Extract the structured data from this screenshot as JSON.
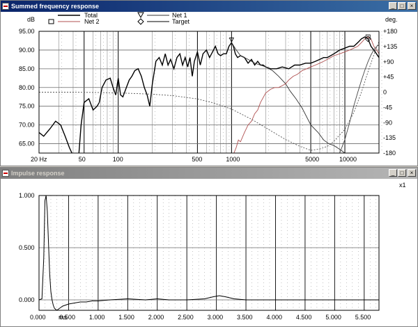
{
  "windows": {
    "freq": {
      "title": "Summed frequency response",
      "y_unit_left": "dB",
      "y_unit_right": "deg.",
      "legend": {
        "total": "Total",
        "net1": "Net 1",
        "net2": "Net 2",
        "target": "Target"
      },
      "controls": {
        "minimize": "_",
        "maximize": "□",
        "close": "×"
      }
    },
    "impulse": {
      "title": "Impulse response",
      "scale_label": "x1",
      "x_unit_label": "ms",
      "controls": {
        "minimize": "_",
        "maximize": "□",
        "close": "×"
      }
    }
  },
  "chart_data": [
    {
      "type": "line",
      "title": "Summed frequency response",
      "xlabel": "",
      "ylabel": "dB",
      "y2label": "deg.",
      "x_scale": "log",
      "xlim": [
        20,
        20000
      ],
      "ylim": [
        62.5,
        95
      ],
      "y2lim": [
        -180,
        180
      ],
      "grid": true,
      "legend_position": "top-left",
      "x_tick_labels": [
        "20 Hz",
        "50",
        "100",
        "500",
        "1000",
        "5000",
        "10000"
      ],
      "x_ticks": [
        20,
        50,
        100,
        500,
        1000,
        5000,
        10000
      ],
      "y_ticks": [
        65,
        70,
        75,
        80,
        85,
        90,
        95
      ],
      "y_tick_labels": [
        "65.00",
        "70.00",
        "75.00",
        "80.00",
        "85.00",
        "90.00",
        "95.00"
      ],
      "y2_ticks": [
        -180,
        -135,
        -90,
        -45,
        0,
        45,
        90,
        135,
        180
      ],
      "y2_tick_labels": [
        "-180",
        "-135",
        "-90",
        "-45",
        "0",
        "+45",
        "+90",
        "+135",
        "+180"
      ],
      "series": [
        {
          "name": "Total",
          "axis": "left",
          "color": "#000000",
          "segments": [
            {
              "x": [
                20,
                22,
                25,
                28,
                31,
                34,
                37,
                39
              ],
              "y": [
                68,
                67,
                69,
                71,
                70,
                67,
                64,
                62.5
              ]
            },
            {
              "x": [
                45,
                47,
                50,
                55,
                60,
                65,
                68
              ],
              "y": [
                62.5,
                70,
                76,
                77,
                74,
                75,
                76
              ]
            },
            {
              "x": [
                68,
                72,
                78,
                85,
                90,
                95,
                100,
                105,
                110,
                118,
                125,
                132,
                140,
                150,
                160,
                170,
                180,
                190,
                200,
                215,
                230,
                245,
                260,
                275,
                290,
                310,
                330,
                350,
                370,
                390,
                410,
                430,
                450,
                470,
                500,
                530,
                560,
                600,
                640,
                680,
                720,
                760,
                800,
                850,
                900,
                950,
                1000,
                1040,
                1080,
                1130,
                1200,
                1300,
                1400,
                1500,
                1600,
                1700,
                1800,
                1900,
                2000,
                2200,
                2500,
                2800,
                3200,
                3600,
                4000,
                4500,
                5000,
                5500,
                6000,
                6500,
                7000,
                7500,
                8000,
                9000,
                10000,
                11000,
                12000,
                13000,
                14000,
                15000,
                16000,
                17000,
                18000,
                19000,
                20000
              ],
              "y": [
                76,
                80,
                82,
                82.5,
                80,
                78,
                82.5,
                78,
                77.5,
                80,
                82,
                83,
                84.5,
                85,
                83,
                80,
                78,
                75,
                81,
                87,
                88,
                86,
                89,
                86,
                87.5,
                85,
                88,
                89,
                86,
                88,
                85.5,
                88,
                83,
                87,
                89.5,
                86,
                89,
                90,
                88,
                89.5,
                91,
                89,
                88.5,
                89,
                89,
                91,
                92,
                91,
                89,
                88,
                88.5,
                88,
                86.5,
                87.5,
                86,
                87,
                86,
                86,
                85.5,
                85,
                85,
                85.5,
                85,
                86,
                86,
                86.5,
                86.5,
                87,
                87.5,
                88,
                88,
                88.5,
                89,
                90,
                90.5,
                91,
                91,
                92,
                93,
                93.5,
                93,
                91,
                90,
                89,
                88
              ]
            }
          ]
        },
        {
          "name": "Net 1",
          "axis": "left",
          "color": "#333333",
          "segments": [
            {
              "x": [
                1000,
                1100,
                1200,
                1400,
                1600,
                1800,
                2000,
                2300,
                2600,
                3000,
                3300,
                3700,
                4200,
                5000,
                5800,
                6500,
                7200,
                8000,
                9000,
                10000
              ],
              "y": [
                92,
                90,
                88.5,
                87.5,
                86.5,
                86,
                85.5,
                84.5,
                83,
                81,
                79,
                77,
                74.5,
                70,
                68,
                66,
                65,
                64.5,
                63.5,
                62.5
              ]
            }
          ]
        },
        {
          "name": "Net 2",
          "axis": "left",
          "color": "#b05050",
          "segments": [
            {
              "x": [
                1050,
                1100,
                1150,
                1200,
                1300,
                1400,
                1500,
                1600,
                1700,
                1800,
                2000,
                2200,
                2400,
                2600,
                2800,
                3000,
                3200,
                3500,
                3800,
                4200,
                4600,
                5000,
                5500,
                6000,
                6500,
                7000,
                7500,
                8000,
                9000,
                10000,
                11000,
                12000,
                13000,
                14000,
                15000,
                16000,
                17000,
                18000,
                19000,
                20000
              ],
              "y": [
                62.5,
                64,
                66,
                65.5,
                68,
                70,
                71,
                73,
                74,
                76,
                78.5,
                79.5,
                80,
                80,
                80.5,
                81,
                82,
                83,
                83.5,
                84.5,
                85,
                85.5,
                86,
                86.5,
                87,
                87.5,
                88,
                88.5,
                89,
                89.5,
                90,
                90.5,
                91,
                92,
                93,
                93.5,
                93,
                91,
                90,
                89
              ]
            }
          ]
        },
        {
          "name": "phase",
          "axis": "right",
          "color": "#555555",
          "dashed": true,
          "segments": [
            {
              "x": [
                20,
                40,
                70,
                120,
                200,
                300,
                500,
                700,
                1000,
                1500,
                2000,
                3000,
                4000,
                5000,
                6000,
                7000,
                8000,
                10000,
                12000,
                14000,
                16000,
                18000,
                20000
              ],
              "y": [
                0,
                0,
                -1,
                -3,
                -6,
                -10,
                -20,
                -32,
                -50,
                -80,
                -105,
                -140,
                -160,
                -172,
                -168,
                -160,
                -145,
                -110,
                -60,
                0,
                60,
                110,
                150
              ]
            }
          ]
        },
        {
          "name": "Net 1 phase",
          "axis": "right",
          "color": "#444444",
          "dashed": false,
          "segments": [
            {
              "x": [
                9000,
                10000,
                11000,
                12000,
                13000,
                14000,
                15000,
                16000,
                17000,
                18000,
                19000,
                20000
              ],
              "y": [
                -180,
                -140,
                -90,
                -40,
                0,
                35,
                65,
                90,
                110,
                125,
                135,
                140
              ]
            }
          ]
        }
      ],
      "markers": [
        {
          "series": "Net 1",
          "shape": "triangle",
          "x": 1000,
          "y": 92.5
        },
        {
          "series": "Net 2",
          "shape": "square",
          "x": 16000,
          "y": 93.5
        },
        {
          "series": "Target",
          "shape": "diamond",
          "x": 16000,
          "y": 93
        }
      ]
    },
    {
      "type": "line",
      "title": "Impulse response",
      "xlabel": "",
      "ylabel": "",
      "xlim": [
        0,
        5.75
      ],
      "ylim": [
        -0.1,
        1.0
      ],
      "grid": true,
      "x_ticks": [
        0,
        0.5,
        1,
        1.5,
        2,
        2.5,
        3,
        3.5,
        4,
        4.5,
        5,
        5.5
      ],
      "x_tick_labels": [
        "0.000",
        "0.500",
        "1.000",
        "1.500",
        "2.000",
        "2.500",
        "3.000",
        "3.500",
        "4.000",
        "4.500",
        "5.000",
        "5.500"
      ],
      "y_ticks": [
        0,
        0.5,
        1.0
      ],
      "y_tick_labels": [
        "0.000",
        "0.500",
        "1.000"
      ],
      "series": [
        {
          "name": "impulse",
          "color": "#000000",
          "x": [
            0,
            0.05,
            0.08,
            0.1,
            0.12,
            0.14,
            0.16,
            0.18,
            0.2,
            0.22,
            0.24,
            0.26,
            0.28,
            0.3,
            0.35,
            0.4,
            0.5,
            0.6,
            0.7,
            0.8,
            0.9,
            1.0,
            1.2,
            1.5,
            1.8,
            2.0,
            2.2,
            2.5,
            2.8,
            2.95,
            3.05,
            3.15,
            3.3,
            3.5,
            3.8,
            4.0,
            4.5,
            5.0,
            5.5,
            5.75
          ],
          "y": [
            0,
            0.01,
            0.4,
            0.95,
            1.0,
            0.85,
            0.55,
            0.25,
            0.08,
            0.0,
            -0.05,
            -0.08,
            -0.09,
            -0.1,
            -0.08,
            -0.06,
            -0.04,
            -0.03,
            -0.02,
            -0.02,
            -0.01,
            -0.01,
            0.0,
            0.01,
            0.0,
            0.01,
            0.0,
            0.0,
            0.01,
            0.03,
            0.04,
            0.03,
            0.01,
            0.0,
            0.0,
            0.0,
            0.0,
            0.0,
            0.0,
            0.0
          ]
        }
      ]
    }
  ]
}
